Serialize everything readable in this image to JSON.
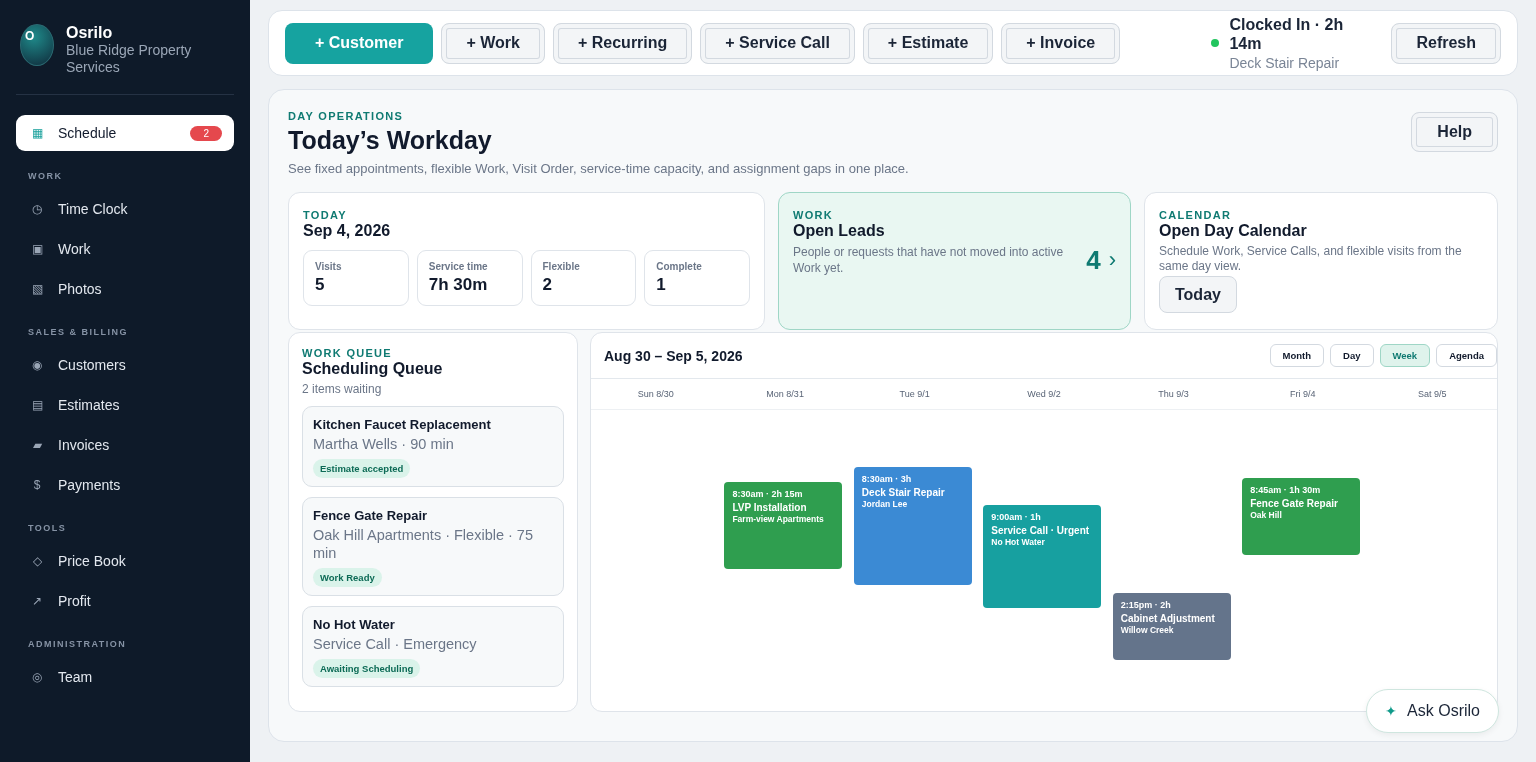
{
  "sidebar": {
    "brand": {
      "logo_letter": "O",
      "name": "Osrilo",
      "subtitle": "Blue Ridge Property Services"
    },
    "top_items": [
      {
        "icon": "▦",
        "label": "Schedule",
        "selected": true,
        "badge": "2"
      }
    ],
    "sections": [
      {
        "title": "WORK",
        "items": [
          {
            "icon": "◷",
            "label": "Time Clock",
            "selected": false
          },
          {
            "icon": "▣",
            "label": "Work",
            "selected": false
          },
          {
            "icon": "▧",
            "label": "Photos",
            "selected": false
          }
        ]
      },
      {
        "title": "SALES & BILLING",
        "items": [
          {
            "icon": "◉",
            "label": "Customers",
            "selected": false
          },
          {
            "icon": "▤",
            "label": "Estimates",
            "selected": false
          },
          {
            "icon": "▰",
            "label": "Invoices",
            "selected": false
          },
          {
            "icon": "$",
            "label": "Payments",
            "selected": false
          }
        ]
      },
      {
        "title": "TOOLS",
        "items": [
          {
            "icon": "◇",
            "label": "Price Book",
            "selected": false
          },
          {
            "icon": "↗",
            "label": "Profit",
            "selected": false
          }
        ]
      },
      {
        "title": "ADMINISTRATION",
        "items": [
          {
            "icon": "◎",
            "label": "Team",
            "selected": false
          }
        ]
      }
    ]
  },
  "toolbar": {
    "buttons": [
      {
        "label": "+ Customer",
        "kind": "primary"
      },
      {
        "label": "+ Work",
        "kind": "secondary"
      },
      {
        "label": "+ Recurring",
        "kind": "secondary"
      },
      {
        "label": "+ Service Call",
        "kind": "secondary"
      },
      {
        "label": "+ Estimate",
        "kind": "secondary"
      },
      {
        "label": "+ Invoice",
        "kind": "secondary"
      }
    ],
    "clock": {
      "clocked_in": true,
      "status": "Clocked In · 2h 14m",
      "job": "Deck Stair Repair"
    },
    "refresh": "Refresh"
  },
  "header": {
    "eyebrow": "DAY OPERATIONS",
    "title": "Today’s Workday",
    "subtitle": "See fixed appointments, flexible Work, Visit Order, service-time capacity, and assignment gaps in one place.",
    "help": "Help"
  },
  "today": {
    "eyebrow": "TODAY",
    "date": "Sep 4, 2026",
    "stats": [
      {
        "label": "Visits",
        "value": "5"
      },
      {
        "label": "Service time",
        "value": "7h 30m"
      },
      {
        "label": "Flexible",
        "value": "2"
      },
      {
        "label": "Complete",
        "value": "1"
      }
    ]
  },
  "leads": {
    "eyebrow": "WORK",
    "title": "Open Leads",
    "description": "People or requests that have not moved into active Work yet.",
    "count": "4",
    "chevron": "›"
  },
  "calendar_card": {
    "eyebrow": "CALENDAR",
    "title": "Open Day Calendar",
    "description": "Schedule Work, Service Calls, and flexible visits from the same day view.",
    "button": "Today"
  },
  "queue": {
    "eyebrow": "WORK QUEUE",
    "title": "Scheduling Queue",
    "count": "2 items waiting",
    "items": [
      {
        "title": "Kitchen Faucet Replacement",
        "meta": "Martha Wells · 90 min",
        "tag": "Estimate accepted"
      },
      {
        "title": "Fence Gate Repair",
        "meta": "Oak Hill Apartments · Flexible · 75 min",
        "tag": "Work Ready"
      },
      {
        "title": "No Hot Water",
        "meta": "Service Call · Emergency",
        "tag": "Awaiting Scheduling"
      }
    ]
  },
  "week": {
    "range": "Aug 30 – Sep 5, 2026",
    "views": [
      {
        "label": "Month",
        "selected": false
      },
      {
        "label": "Day",
        "selected": false
      },
      {
        "label": "Week",
        "selected": true
      },
      {
        "label": "Agenda",
        "selected": false
      }
    ],
    "days": [
      "Sun 8/30",
      "Mon 8/31",
      "Tue 9/1",
      "Wed 9/2",
      "Thu 9/3",
      "Fri 9/4",
      "Sat 9/5"
    ],
    "events": [
      {
        "time": "8:30am · 2h 15m",
        "title": "LVP Installation",
        "subtitle": "Farm-view Apartments",
        "color": "#2f9e4f"
      },
      {
        "time": "8:30am · 3h",
        "title": "Deck Stair Repair",
        "subtitle": "Jordan Lee",
        "color": "#3b8ad4"
      },
      {
        "time": "9:00am · 1h",
        "title": "Service Call · Urgent",
        "subtitle": "No Hot Water",
        "color": "#17a0a0"
      },
      {
        "time": "2:15pm · 2h",
        "title": "Cabinet Adjustment",
        "subtitle": "Willow Creek",
        "color": "#64748b"
      },
      {
        "time": "8:45am · 1h 30m",
        "title": "Fence Gate Repair",
        "subtitle": "Oak Hill",
        "color": "#2f9e4f"
      }
    ]
  },
  "assistant": {
    "icon": "✦",
    "label": "Ask Osrilo"
  }
}
